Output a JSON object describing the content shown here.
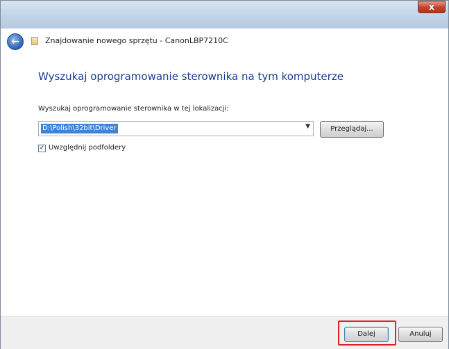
{
  "window": {
    "title": "Znajdowanie nowego sprzętu - CanonLBP7210C",
    "close_label": "x"
  },
  "main": {
    "instruction": "Wyszukaj oprogramowanie sterownika na tym komputerze",
    "location_label": "Wyszukaj oprogramowanie sterownika w tej lokalizacji:",
    "location_value": "D:\\Polish\\32bit\\Driver",
    "browse_label": "Przeglądaj...",
    "include_subfolders_label": "Uwzględnij podfoldery",
    "include_subfolders_checked": true
  },
  "footer": {
    "next_label": "Dalej",
    "cancel_label": "Anuluj"
  },
  "colors": {
    "instruction": "#1a3d8f",
    "selection": "#3d84d8",
    "highlight": "#e0202a"
  }
}
